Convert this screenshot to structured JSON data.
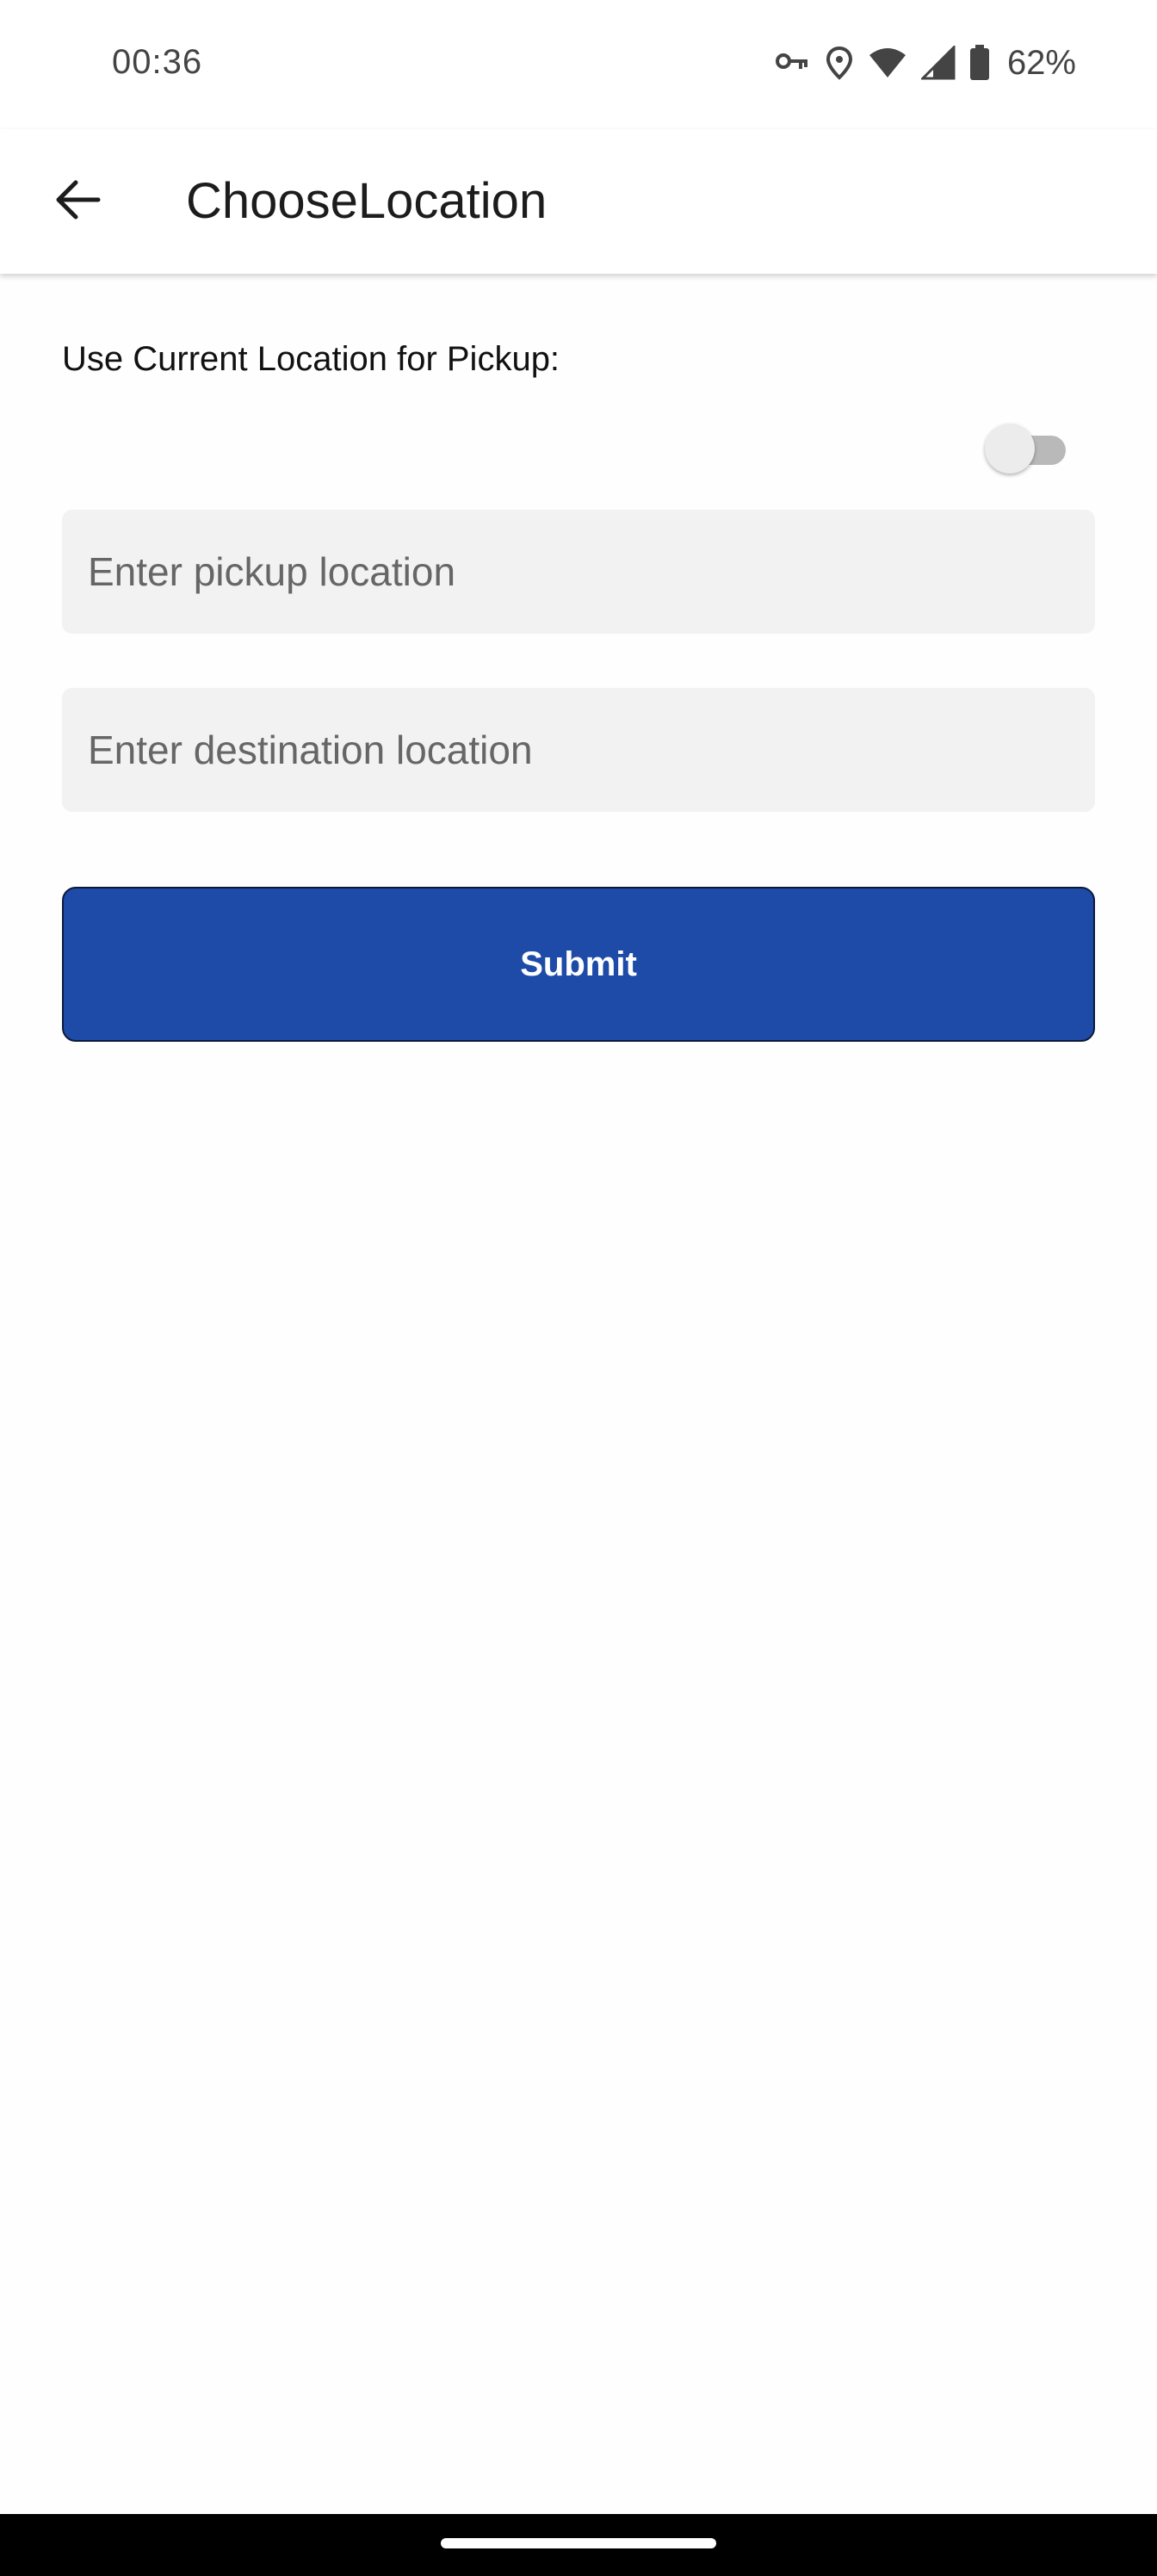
{
  "status_bar": {
    "time": "00:36",
    "battery_percent": "62%",
    "icons": [
      "vpn-key-icon",
      "location-pin-icon",
      "wifi-icon",
      "cell-signal-icon",
      "battery-icon"
    ]
  },
  "app_bar": {
    "title": "ChooseLocation",
    "back_icon": "arrow-back-icon"
  },
  "form": {
    "current_location_label": "Use Current Location for Pickup:",
    "use_current_location": false,
    "pickup": {
      "value": "",
      "placeholder": "Enter pickup location"
    },
    "destination": {
      "value": "",
      "placeholder": "Enter destination location"
    },
    "submit_label": "Submit"
  },
  "colors": {
    "primary": "#1e4ba8",
    "field_background": "#f2f2f2",
    "background": "#fefefe",
    "toggle_track_off": "#b9b9b9"
  }
}
